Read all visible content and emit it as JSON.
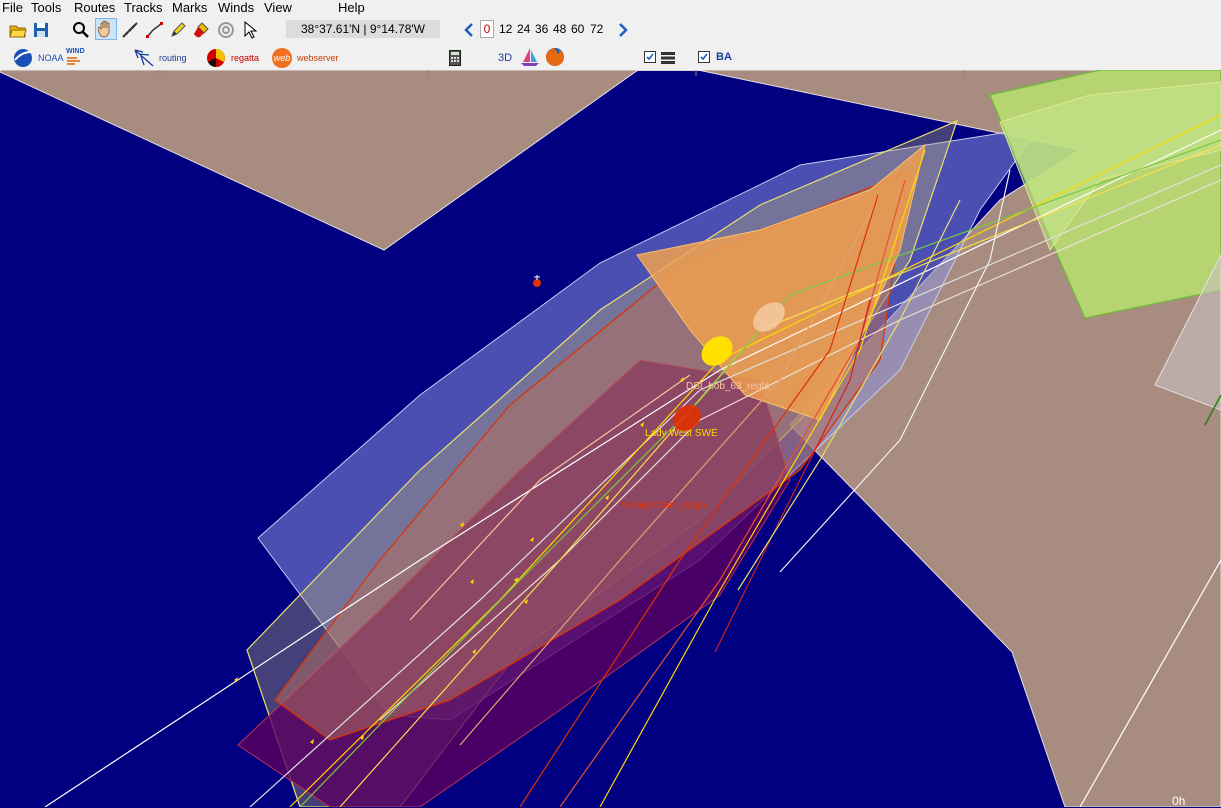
{
  "menu": [
    "File",
    "Tools",
    "Routes",
    "Tracks",
    "Marks",
    "Winds",
    "View",
    "Help"
  ],
  "toolbar": {
    "position_readout": "38°37.61'N |  9°14.78'W",
    "selected_hour": "0",
    "forecast_hours": [
      "12",
      "24",
      "36",
      "48",
      "60",
      "72"
    ],
    "noaa_label": "NOAA",
    "wind_label": "WIND",
    "routing_label": "routing",
    "regatta_label": "regatta",
    "web_label": "web",
    "webserver_label": "webserver",
    "threed_label": "3D",
    "ba_label": "BA",
    "layers_checked": true,
    "ba_checked": true
  },
  "map": {
    "boats": [
      {
        "name": "DSI_bob_63_regla",
        "color": "#f5c8a0"
      },
      {
        "name": "Lady West SWE",
        "color": "#ffd700"
      },
      {
        "name": "Meiagobdom_regla",
        "color": "#e03000"
      }
    ],
    "time_label": "0h",
    "colors": {
      "sea": "#000080",
      "land": "#a88c80",
      "route_yellow": "#ffd700",
      "route_red": "#e03000",
      "route_green": "#7ac943"
    }
  }
}
